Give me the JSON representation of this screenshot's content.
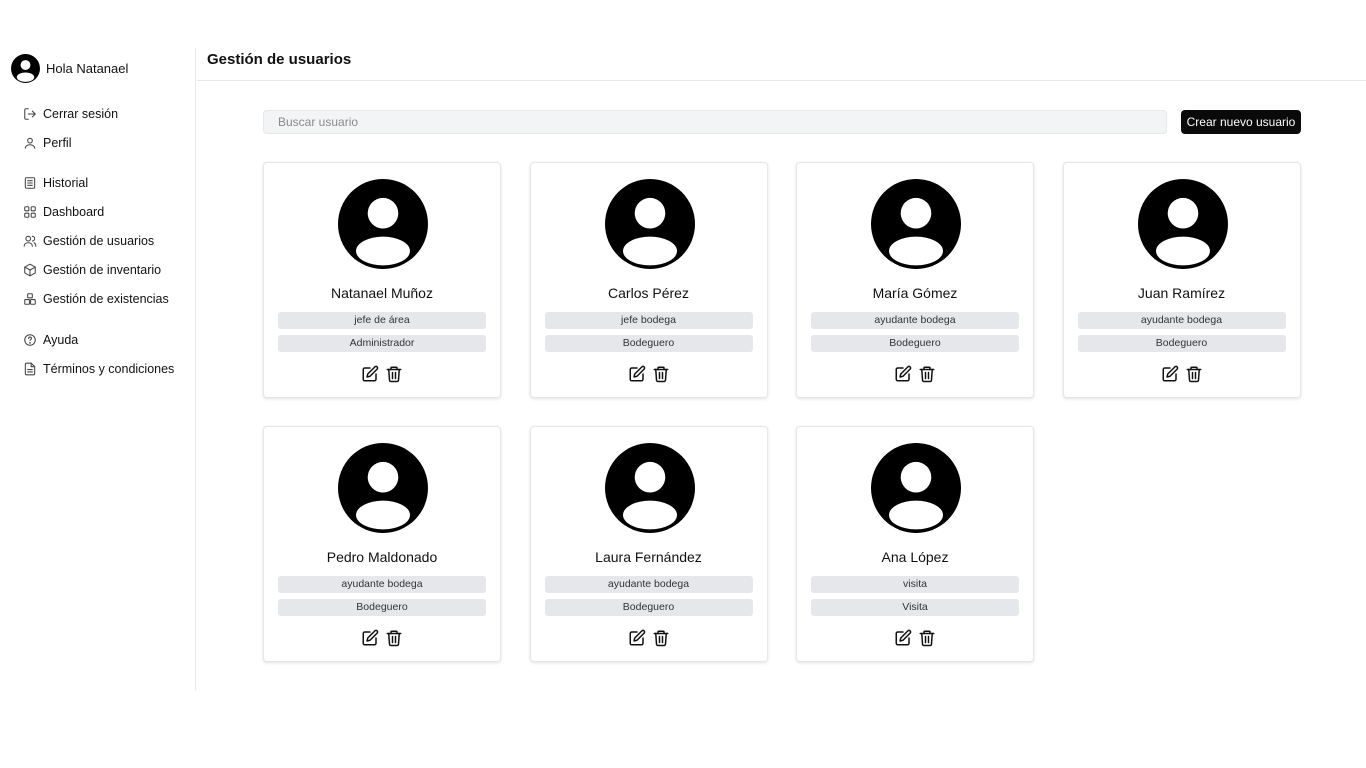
{
  "sidebar": {
    "greeting": "Hola Natanael",
    "items": [
      {
        "label": "Cerrar sesión",
        "icon": "logout-icon"
      },
      {
        "label": "Perfil",
        "icon": "user-icon"
      },
      {
        "label": "Historial",
        "icon": "document-list-icon"
      },
      {
        "label": "Dashboard",
        "icon": "grid-icon"
      },
      {
        "label": "Gestión de usuarios",
        "icon": "users-icon"
      },
      {
        "label": "Gestión de inventario",
        "icon": "box-icon"
      },
      {
        "label": "Gestión de existencias",
        "icon": "boxes-stack-icon"
      },
      {
        "label": "Ayuda",
        "icon": "help-circle-icon"
      },
      {
        "label": "Términos y condiciones",
        "icon": "file-text-icon"
      }
    ]
  },
  "header": {
    "title": "Gestión de usuarios"
  },
  "search": {
    "placeholder": "Buscar usuario",
    "value": ""
  },
  "toolbar": {
    "create_label": "Crear nuevo usuario"
  },
  "users": [
    {
      "name": "Natanael Muñoz",
      "role": "jefe de área",
      "type": "Administrador"
    },
    {
      "name": "Carlos Pérez",
      "role": "jefe bodega",
      "type": "Bodeguero"
    },
    {
      "name": "María Gómez",
      "role": "ayudante bodega",
      "type": "Bodeguero"
    },
    {
      "name": "Juan Ramírez",
      "role": "ayudante bodega",
      "type": "Bodeguero"
    },
    {
      "name": "Pedro Maldonado",
      "role": "ayudante bodega",
      "type": "Bodeguero"
    },
    {
      "name": "Laura Fernández",
      "role": "ayudante bodega",
      "type": "Bodeguero"
    },
    {
      "name": "Ana López",
      "role": "visita",
      "type": "Visita"
    }
  ]
}
